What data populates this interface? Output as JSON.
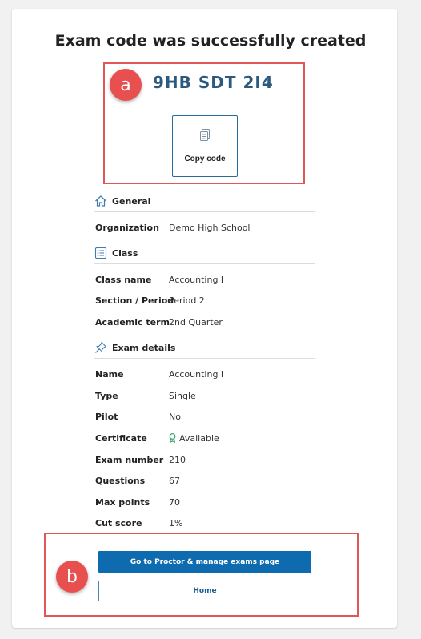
{
  "page": {
    "title": "Exam code was successfully created"
  },
  "code": {
    "value": "9HB SDT 2I4",
    "copy_label": "Copy code"
  },
  "callouts": {
    "a": "a",
    "b": "b"
  },
  "sections": {
    "general": {
      "title": "General",
      "rows": [
        {
          "label": "Organization",
          "value": "Demo High School"
        }
      ]
    },
    "class": {
      "title": "Class",
      "rows": [
        {
          "label": "Class name",
          "value": "Accounting I"
        },
        {
          "label": "Section / Period",
          "value": "Period 2"
        },
        {
          "label": "Academic term",
          "value": "2nd Quarter"
        }
      ]
    },
    "exam_details": {
      "title": "Exam details",
      "rows": [
        {
          "label": "Name",
          "value": "Accounting I"
        },
        {
          "label": "Type",
          "value": "Single"
        },
        {
          "label": "Pilot",
          "value": "No"
        },
        {
          "label": "Certificate",
          "value": "Available"
        },
        {
          "label": "Exam number",
          "value": "210"
        },
        {
          "label": "Questions",
          "value": "67"
        },
        {
          "label": "Max points",
          "value": "70"
        },
        {
          "label": "Cut score",
          "value": "1%"
        }
      ]
    }
  },
  "actions": {
    "primary_label": "Go to Proctor & manage exams page",
    "secondary_label": "Home"
  },
  "colors": {
    "accent": "#0f6bb0",
    "code_text": "#2b5a7e",
    "callout": "#e84f4f",
    "certificate_icon": "#2e9d6a"
  },
  "icons": {
    "copy": "copy-icon",
    "general": "home-icon",
    "class": "list-icon",
    "exam_details": "pin-icon",
    "certificate": "award-icon"
  }
}
